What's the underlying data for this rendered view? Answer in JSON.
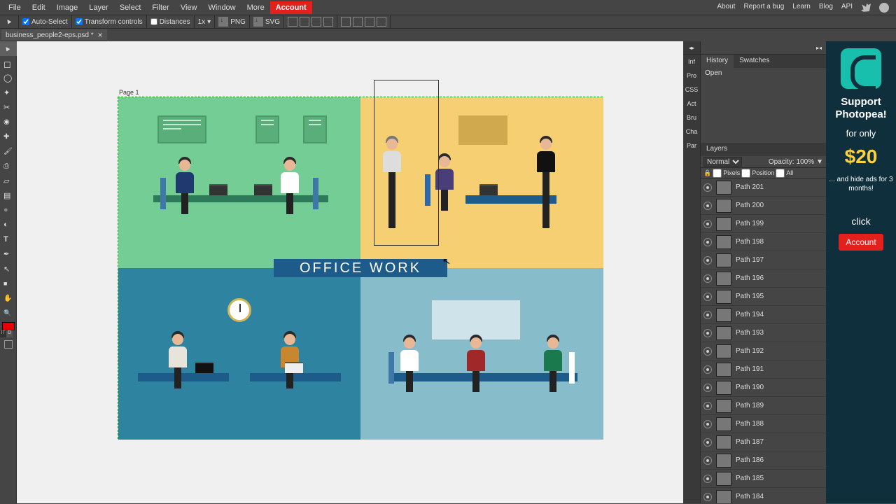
{
  "menu": {
    "items": [
      "File",
      "Edit",
      "Image",
      "Layer",
      "Select",
      "Filter",
      "View",
      "Window",
      "More"
    ],
    "account": "Account",
    "right": [
      "About",
      "Report a bug",
      "Learn",
      "Blog",
      "API"
    ]
  },
  "optionsbar": {
    "autoSelect": "Auto-Select",
    "transform": "Transform controls",
    "distances": "Distances",
    "scale": "1x",
    "png": "PNG",
    "svg": "SVG"
  },
  "tab": {
    "filename": "business_people2-eps.psd *"
  },
  "canvas": {
    "pageLabel": "Page 1",
    "centerText": "OFFICE WORK"
  },
  "miniTabs": [
    "Inf",
    "Pro",
    "CSS",
    "Act",
    "Bru",
    "Cha",
    "Par"
  ],
  "historyPanel": {
    "tabs": [
      "History",
      "Swatches"
    ],
    "active": 0,
    "entries": [
      "Open"
    ]
  },
  "layersPanel": {
    "title": "Layers",
    "blend": "Normal",
    "opacityLbl": "Opacity:",
    "opacityVal": "100%",
    "lockLbls": [
      "Pixels",
      "Position",
      "All"
    ],
    "layers": [
      "Path 201",
      "Path 200",
      "Path 199",
      "Path 198",
      "Path 197",
      "Path 196",
      "Path 195",
      "Path 194",
      "Path 193",
      "Path 192",
      "Path 191",
      "Path 190",
      "Path 189",
      "Path 188",
      "Path 187",
      "Path 186",
      "Path 185",
      "Path 184"
    ]
  },
  "promo": {
    "line1": "Support Photopea!",
    "line2": "for only",
    "price": "$20",
    "line3": "... and hide ads for 3 months!",
    "line4": "click",
    "btn": "Account"
  }
}
